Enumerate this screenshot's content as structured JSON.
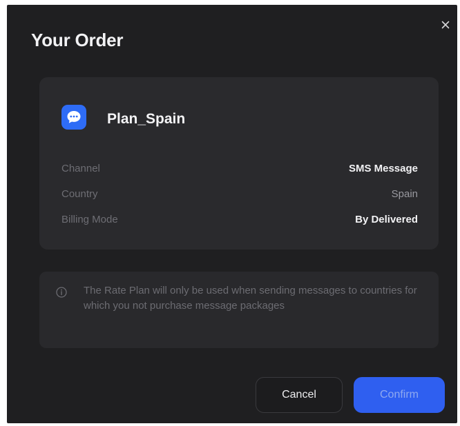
{
  "dialog": {
    "title": "Your Order",
    "close_icon": "close-icon"
  },
  "plan": {
    "icon": "chat-bubble-icon",
    "icon_color": "#2e6cf6",
    "name": "Plan_Spain",
    "details": {
      "channel_label": "Channel",
      "channel_value": "SMS Message",
      "country_label": "Country",
      "country_value": "Spain",
      "billing_label": "Billing Mode",
      "billing_value": "By Delivered"
    }
  },
  "notice": {
    "icon": "info-icon",
    "text": "The Rate Plan will only be used when sending messages to countries for which you not purchase message packages"
  },
  "actions": {
    "cancel_label": "Cancel",
    "confirm_label": "Confirm",
    "confirm_color": "#2f5ff0"
  }
}
